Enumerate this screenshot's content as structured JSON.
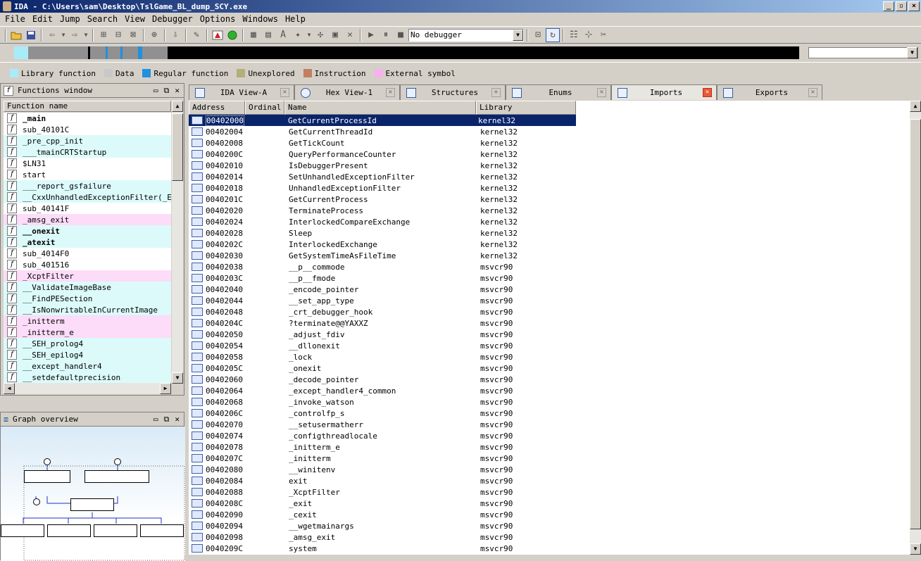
{
  "window": {
    "title": "IDA - C:\\Users\\sam\\Desktop\\TslGame_BL_dump_SCY.exe",
    "min": "_",
    "max": "▫",
    "close": "×"
  },
  "menu": [
    "File",
    "Edit",
    "Jump",
    "Search",
    "View",
    "Debugger",
    "Options",
    "Windows",
    "Help"
  ],
  "toolbar": {
    "debugger_value": "No debugger"
  },
  "legend": [
    {
      "label": "Library function",
      "color": "#a8ecf8"
    },
    {
      "label": "Data",
      "color": "#c8c8c8"
    },
    {
      "label": "Regular function",
      "color": "#2090e0"
    },
    {
      "label": "Unexplored",
      "color": "#b0b078"
    },
    {
      "label": "Instruction",
      "color": "#c08060"
    },
    {
      "label": "External symbol",
      "color": "#f8b0f0"
    }
  ],
  "functions_window": {
    "title": "Functions window",
    "column": "Function name",
    "items": [
      {
        "name": "_main",
        "bold": true,
        "bg": "#ffffff"
      },
      {
        "name": "sub_40101C",
        "bold": false,
        "bg": "#ffffff"
      },
      {
        "name": "_pre_cpp_init",
        "bold": false,
        "bg": "#dcfafa"
      },
      {
        "name": "___tmainCRTStartup",
        "bold": false,
        "bg": "#dcfafa"
      },
      {
        "name": "$LN31",
        "bold": false,
        "bg": "#ffffff"
      },
      {
        "name": "start",
        "bold": false,
        "bg": "#ffffff"
      },
      {
        "name": "___report_gsfailure",
        "bold": false,
        "bg": "#dcfafa"
      },
      {
        "name": "__CxxUnhandledExceptionFilter(_EXCEP",
        "bold": false,
        "bg": "#dcfafa"
      },
      {
        "name": "sub_40141F",
        "bold": false,
        "bg": "#ffffff"
      },
      {
        "name": "_amsg_exit",
        "bold": false,
        "bg": "#fcdcf8"
      },
      {
        "name": "__onexit",
        "bold": true,
        "bg": "#dcfafa"
      },
      {
        "name": "_atexit",
        "bold": true,
        "bg": "#dcfafa"
      },
      {
        "name": "sub_4014F0",
        "bold": false,
        "bg": "#ffffff"
      },
      {
        "name": "sub_401516",
        "bold": false,
        "bg": "#ffffff"
      },
      {
        "name": "_XcptFilter",
        "bold": false,
        "bg": "#fcdcf8"
      },
      {
        "name": "__ValidateImageBase",
        "bold": false,
        "bg": "#dcfafa"
      },
      {
        "name": "__FindPESection",
        "bold": false,
        "bg": "#dcfafa"
      },
      {
        "name": "__IsNonwritableInCurrentImage",
        "bold": false,
        "bg": "#dcfafa"
      },
      {
        "name": "_initterm",
        "bold": false,
        "bg": "#fcdcf8"
      },
      {
        "name": "_initterm_e",
        "bold": false,
        "bg": "#fcdcf8"
      },
      {
        "name": "__SEH_prolog4",
        "bold": false,
        "bg": "#dcfafa"
      },
      {
        "name": "__SEH_epilog4",
        "bold": false,
        "bg": "#dcfafa"
      },
      {
        "name": "__except_handler4",
        "bold": false,
        "bg": "#dcfafa"
      },
      {
        "name": "__setdefaultprecision",
        "bold": false,
        "bg": "#dcfafa"
      }
    ]
  },
  "graph_overview": {
    "title": "Graph overview"
  },
  "tabs": [
    {
      "label": "IDA View-A",
      "active": false
    },
    {
      "label": "Hex View-1",
      "active": false
    },
    {
      "label": "Structures",
      "active": false
    },
    {
      "label": "Enums",
      "active": false
    },
    {
      "label": "Imports",
      "active": true
    },
    {
      "label": "Exports",
      "active": false
    }
  ],
  "imports": {
    "columns": [
      "Address",
      "Ordinal",
      "Name",
      "Library"
    ],
    "rows": [
      [
        "00402000",
        "",
        "GetCurrentProcessId",
        "kernel32"
      ],
      [
        "00402004",
        "",
        "GetCurrentThreadId",
        "kernel32"
      ],
      [
        "00402008",
        "",
        "GetTickCount",
        "kernel32"
      ],
      [
        "0040200C",
        "",
        "QueryPerformanceCounter",
        "kernel32"
      ],
      [
        "00402010",
        "",
        "IsDebuggerPresent",
        "kernel32"
      ],
      [
        "00402014",
        "",
        "SetUnhandledExceptionFilter",
        "kernel32"
      ],
      [
        "00402018",
        "",
        "UnhandledExceptionFilter",
        "kernel32"
      ],
      [
        "0040201C",
        "",
        "GetCurrentProcess",
        "kernel32"
      ],
      [
        "00402020",
        "",
        "TerminateProcess",
        "kernel32"
      ],
      [
        "00402024",
        "",
        "InterlockedCompareExchange",
        "kernel32"
      ],
      [
        "00402028",
        "",
        "Sleep",
        "kernel32"
      ],
      [
        "0040202C",
        "",
        "InterlockedExchange",
        "kernel32"
      ],
      [
        "00402030",
        "",
        "GetSystemTimeAsFileTime",
        "kernel32"
      ],
      [
        "00402038",
        "",
        "__p__commode",
        "msvcr90"
      ],
      [
        "0040203C",
        "",
        "__p__fmode",
        "msvcr90"
      ],
      [
        "00402040",
        "",
        "_encode_pointer",
        "msvcr90"
      ],
      [
        "00402044",
        "",
        "__set_app_type",
        "msvcr90"
      ],
      [
        "00402048",
        "",
        "_crt_debugger_hook",
        "msvcr90"
      ],
      [
        "0040204C",
        "",
        "?terminate@@YAXXZ",
        "msvcr90"
      ],
      [
        "00402050",
        "",
        "_adjust_fdiv",
        "msvcr90"
      ],
      [
        "00402054",
        "",
        "__dllonexit",
        "msvcr90"
      ],
      [
        "00402058",
        "",
        "_lock",
        "msvcr90"
      ],
      [
        "0040205C",
        "",
        "_onexit",
        "msvcr90"
      ],
      [
        "00402060",
        "",
        "_decode_pointer",
        "msvcr90"
      ],
      [
        "00402064",
        "",
        "_except_handler4_common",
        "msvcr90"
      ],
      [
        "00402068",
        "",
        "_invoke_watson",
        "msvcr90"
      ],
      [
        "0040206C",
        "",
        "_controlfp_s",
        "msvcr90"
      ],
      [
        "00402070",
        "",
        "__setusermatherr",
        "msvcr90"
      ],
      [
        "00402074",
        "",
        "_configthreadlocale",
        "msvcr90"
      ],
      [
        "00402078",
        "",
        "_initterm_e",
        "msvcr90"
      ],
      [
        "0040207C",
        "",
        "_initterm",
        "msvcr90"
      ],
      [
        "00402080",
        "",
        "__winitenv",
        "msvcr90"
      ],
      [
        "00402084",
        "",
        "exit",
        "msvcr90"
      ],
      [
        "00402088",
        "",
        "_XcptFilter",
        "msvcr90"
      ],
      [
        "0040208C",
        "",
        "_exit",
        "msvcr90"
      ],
      [
        "00402090",
        "",
        "_cexit",
        "msvcr90"
      ],
      [
        "00402094",
        "",
        "__wgetmainargs",
        "msvcr90"
      ],
      [
        "00402098",
        "",
        "_amsg_exit",
        "msvcr90"
      ],
      [
        "0040209C",
        "",
        "system",
        "msvcr90"
      ]
    ]
  }
}
